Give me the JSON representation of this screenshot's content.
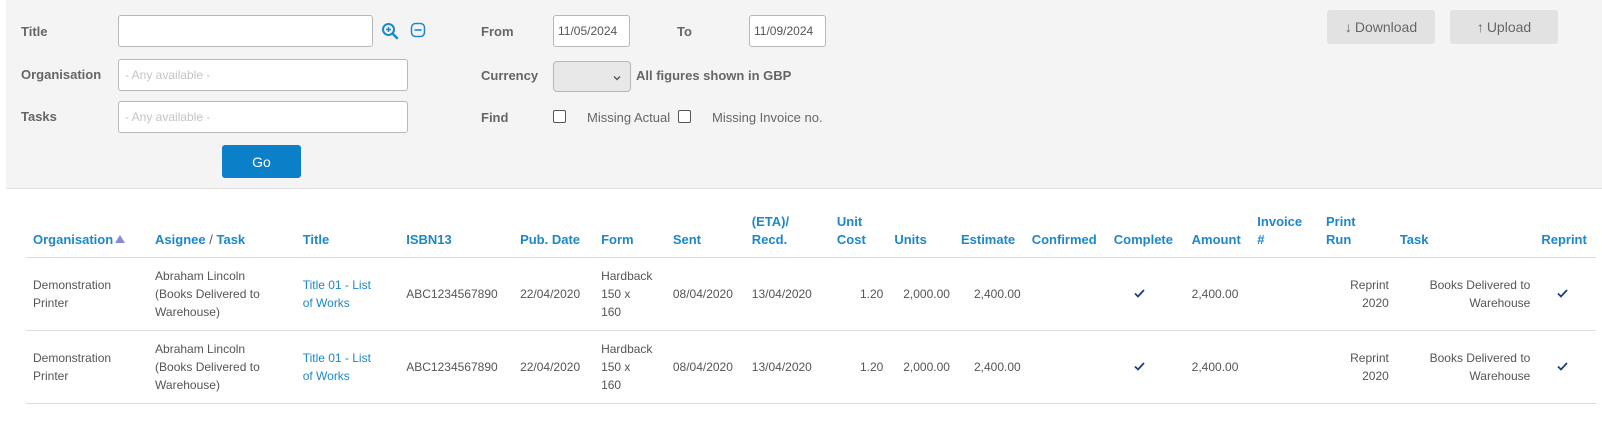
{
  "filters": {
    "title_label": "Title",
    "title_value": "",
    "organisation_label": "Organisation",
    "organisation_placeholder": "- Any available -",
    "tasks_label": "Tasks",
    "tasks_placeholder": "- Any available -",
    "go_label": "Go",
    "from_label": "From",
    "from_value": "11/05/2024",
    "to_label": "To",
    "to_value": "11/09/2024",
    "currency_label": "Currency",
    "currency_value": "",
    "currency_note": "All figures shown in GBP",
    "find_label": "Find",
    "missing_actual_label": "Missing Actual",
    "missing_invoice_label": "Missing Invoice no.",
    "missing_actual_checked": false,
    "missing_invoice_checked": false
  },
  "toolbar": {
    "download_label": "Download",
    "download_glyph": "↓",
    "upload_label": "Upload",
    "upload_glyph": "↑"
  },
  "table": {
    "headers": {
      "organisation": "Organisation",
      "asignee": "Asignee",
      "slash": "/",
      "task_sub": "Task",
      "title": "Title",
      "isbn": "ISBN13",
      "pub_date": "Pub. Date",
      "form": "Form",
      "sent": "Sent",
      "eta_1": "(ETA)/",
      "eta_2": "Recd.",
      "unit_cost_1": "Unit",
      "unit_cost_2": "Cost",
      "units": "Units",
      "estimate": "Estimate",
      "confirmed": "Confirmed",
      "complete": "Complete",
      "amount": "Amount",
      "invoice_1": "Invoice",
      "invoice_2": "#",
      "print_run_1": "Print",
      "print_run_2": "Run",
      "task": "Task",
      "reprint": "Reprint"
    },
    "rows": [
      {
        "organisation": [
          "Demonstration",
          "Printer"
        ],
        "asignee": [
          "Abraham Lincoln",
          "(Books Delivered to",
          "Warehouse)"
        ],
        "title": [
          "Title 01 - List",
          "of Works"
        ],
        "isbn": "ABC1234567890",
        "pub_date": "22/04/2020",
        "form": [
          "Hardback",
          "150 x",
          "160"
        ],
        "sent": "08/04/2020",
        "recd": "13/04/2020",
        "unit_cost": "1.20",
        "units": "2,000.00",
        "estimate": "2,400.00",
        "confirmed": "",
        "complete": true,
        "amount": "2,400.00",
        "invoice": "",
        "print_run": [
          "Reprint",
          "2020"
        ],
        "task": [
          "Books Delivered to",
          "Warehouse"
        ],
        "reprint": true
      },
      {
        "organisation": [
          "Demonstration",
          "Printer"
        ],
        "asignee": [
          "Abraham Lincoln",
          "(Books Delivered to",
          "Warehouse)"
        ],
        "title": [
          "Title 01 - List",
          "of Works"
        ],
        "isbn": "ABC1234567890",
        "pub_date": "22/04/2020",
        "form": [
          "Hardback",
          "150 x",
          "160"
        ],
        "sent": "08/04/2020",
        "recd": "13/04/2020",
        "unit_cost": "1.20",
        "units": "2,000.00",
        "estimate": "2,400.00",
        "confirmed": "",
        "complete": true,
        "amount": "2,400.00",
        "invoice": "",
        "print_run": [
          "Reprint",
          "2020"
        ],
        "task": [
          "Books Delivered to",
          "Warehouse"
        ],
        "reprint": true
      }
    ]
  },
  "icons": {
    "zoom": "zoom-in-icon",
    "collapse": "minus-circle-icon",
    "check": "check-icon",
    "sort": "sort-up-icon",
    "chevron": "chevron-down-icon"
  },
  "colors": {
    "accent": "#1b88cc",
    "primary_button": "#0b80c9",
    "panel": "#f4f4f4",
    "sort_arrow": "#8a8ad8"
  }
}
